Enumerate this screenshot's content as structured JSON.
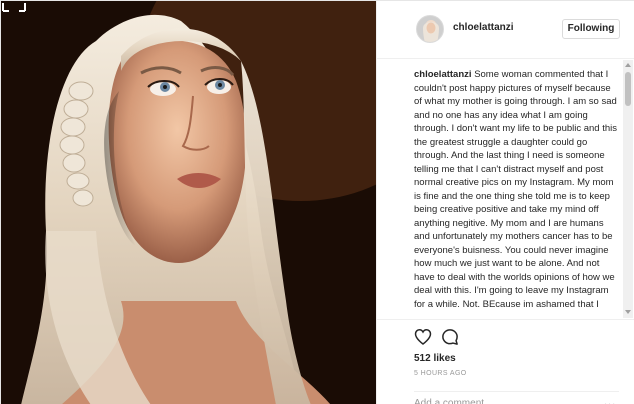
{
  "post": {
    "username": "chloelattanzi",
    "follow_button": "Following",
    "caption_user": "chloelattanzi",
    "caption_text": "Some woman commented that I couldn't post happy pictures of myself because of what my mother is going through. I am so sad and no one has any idea what I am going through. I don't want my life to be public and this the greatest struggle a daughter could go through. And the last thing I need is someone telling me that I can't distract myself and post normal creative pics on my Instagram. My mom is fine and the one thing she told me is to keep being creative positive and take my mind off anything negitive. My mom and I are humans and unfortunately my mothers cancer has to be everyone's buisness. You could never imagine how much we just want to be alone. And not have to deal with the worlds opinions of how we deal with this. I'm going to leave my Instagram for a while. Not. BEcause im ashamed that I",
    "likes": "512 likes",
    "time": "5 HOURS AGO",
    "add_comment_placeholder": "Add a comment...",
    "more": "..."
  },
  "icons": {
    "expand": "expand-icon",
    "heart": "heart-icon",
    "comment": "comment-icon",
    "more": "more-options-icon"
  },
  "colors": {
    "text": "#262626",
    "muted": "#999999",
    "border": "#dbdbdb"
  }
}
